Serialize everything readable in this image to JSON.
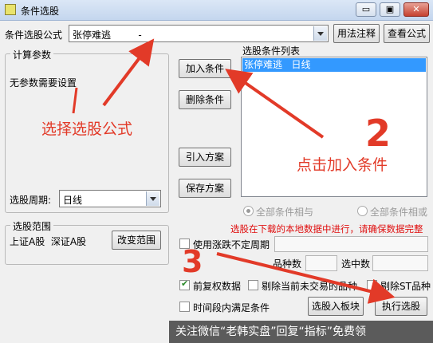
{
  "window": {
    "title": "条件选股",
    "minimize_glyph": "▭",
    "maximize_glyph": "▣",
    "close_glyph": "✕"
  },
  "formula": {
    "label": "条件选股公式",
    "value": "张停难逃         -",
    "usage_button": "用法注释",
    "view_button": "查看公式"
  },
  "params": {
    "group_label": "计算参数",
    "text": "无参数需要设置",
    "period_label": "选股周期:",
    "period_value": "日线"
  },
  "actions": {
    "add": "加入条件",
    "delete": "删除条件",
    "import": "引入方案",
    "save": "保存方案"
  },
  "condition_list": {
    "label": "选股条件列表",
    "items": [
      "张停难逃   日线"
    ]
  },
  "logic": {
    "and_label": "全部条件相与",
    "or_label": "全部条件相或",
    "selected": "and"
  },
  "warning": "选股在下载的本地数据中进行，请确保数据完整",
  "range": {
    "group_label": "选股范围",
    "text": "上证A股  深证A股",
    "change_button": "改变范围"
  },
  "options": {
    "irregular_period": {
      "label": "使用涨跌不定周期",
      "checked": false
    },
    "variety_count_label": "品种数",
    "selected_count_label": "选中数",
    "prior_adjust": {
      "label": "前复权数据",
      "checked": true
    },
    "exclude_untraded": {
      "label": "剔除当前未交易的品种",
      "checked": false
    },
    "exclude_st": {
      "label": "剔除ST品种",
      "checked": false
    },
    "time_range": {
      "label": "时间段内满足条件",
      "checked": false
    }
  },
  "bottom_buttons": {
    "to_block": "选股入板块",
    "execute": "执行选股"
  },
  "annotations": {
    "step1": "选择选股公式",
    "step2_num": "2",
    "step2": "点击加入条件",
    "step3_num": "3"
  },
  "footer": "关注微信“老韩实盘”回复“指标”免费领"
}
